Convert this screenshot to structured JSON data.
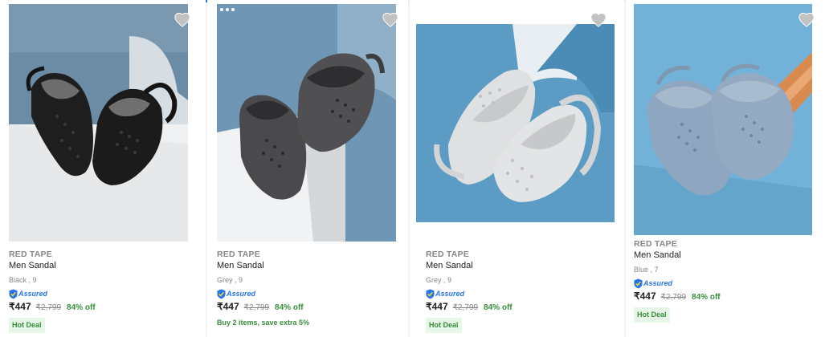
{
  "products": [
    {
      "brand": "RED TAPE",
      "title": "Men Sandal",
      "variant": "Black , 9",
      "assured_label": "Assured",
      "price": "₹447",
      "mrp": "₹2,799",
      "discount": "84% off",
      "badge": "Hot Deal",
      "image_icon": "black-clog-sandal-image",
      "colors": {
        "clog": "#1e1e1e",
        "bg": "#6c8ca6"
      }
    },
    {
      "brand": "RED TAPE",
      "title": "Men Sandal",
      "variant": "Grey , 9",
      "assured_label": "Assured",
      "price": "₹447",
      "mrp": "₹2,799",
      "discount": "84% off",
      "offer": "Buy 2 items, save extra 5%",
      "image_icon": "grey-clog-sandal-image",
      "colors": {
        "clog": "#4a4a4c",
        "bg": "#6f96b4"
      }
    },
    {
      "brand": "RED TAPE",
      "title": "Men Sandal",
      "variant": "Grey , 9",
      "assured_label": "Assured",
      "price": "₹447",
      "mrp": "₹2,799",
      "discount": "84% off",
      "badge": "Hot Deal",
      "image_icon": "light-grey-clog-sandal-image",
      "colors": {
        "clog": "#dfe0e1",
        "bg": "#5c9cc4"
      }
    },
    {
      "brand": "RED TAPE",
      "title": "Men Sandal",
      "variant": "Blue , 7",
      "assured_label": "Assured",
      "price": "₹447",
      "mrp": "₹2,799",
      "discount": "84% off",
      "badge": "Hot Deal",
      "image_icon": "blue-clog-sandal-image",
      "colors": {
        "clog": "#8ea6bf",
        "bg": "#73b2d8"
      }
    }
  ],
  "icons": {
    "wishlist": "heart-icon",
    "more": "more-options-icon",
    "assured": "assured-shield-icon"
  },
  "colors": {
    "accent": "#2874f0",
    "green": "#388e3c",
    "muted": "#878787",
    "text": "#212121"
  }
}
